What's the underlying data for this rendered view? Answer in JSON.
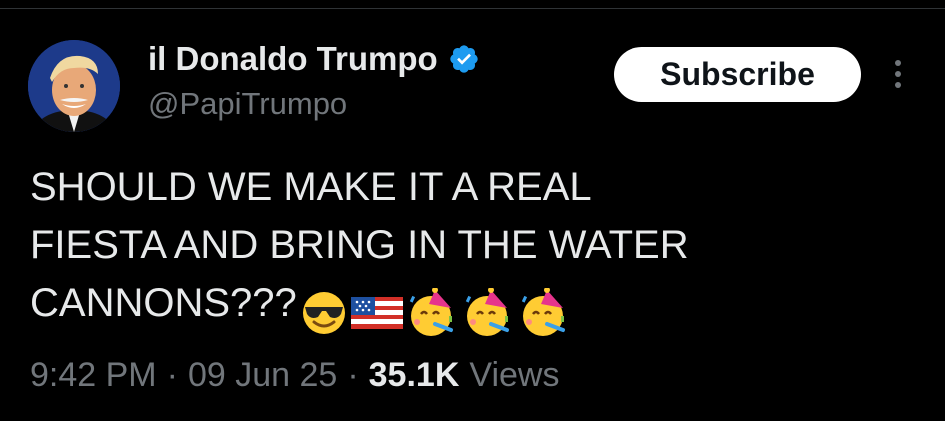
{
  "tweet": {
    "author": {
      "display_name": "il Donaldo Trumpo",
      "handle": "@PapiTrumpo",
      "verified": true,
      "avatar_icon": "person-avatar"
    },
    "subscribe_label": "Subscribe",
    "more_icon": "more-vertical-icon",
    "text": "SHOULD WE MAKE IT A REAL\nFIESTA AND BRING IN THE WATER\nCANNONS???",
    "emojis": [
      "smiling-face-with-sunglasses",
      "us-flag",
      "partying-face",
      "partying-face",
      "partying-face"
    ],
    "time": "9:42 PM",
    "separator": "·",
    "date": "09 Jun 25",
    "views_count": "35.1K",
    "views_label": "Views"
  },
  "colors": {
    "background": "#000000",
    "primary_text": "#e7e9ea",
    "secondary_text": "#71767b",
    "verified_badge": "#1d9bf0",
    "button_bg": "#ffffff",
    "button_text": "#0f1419"
  }
}
